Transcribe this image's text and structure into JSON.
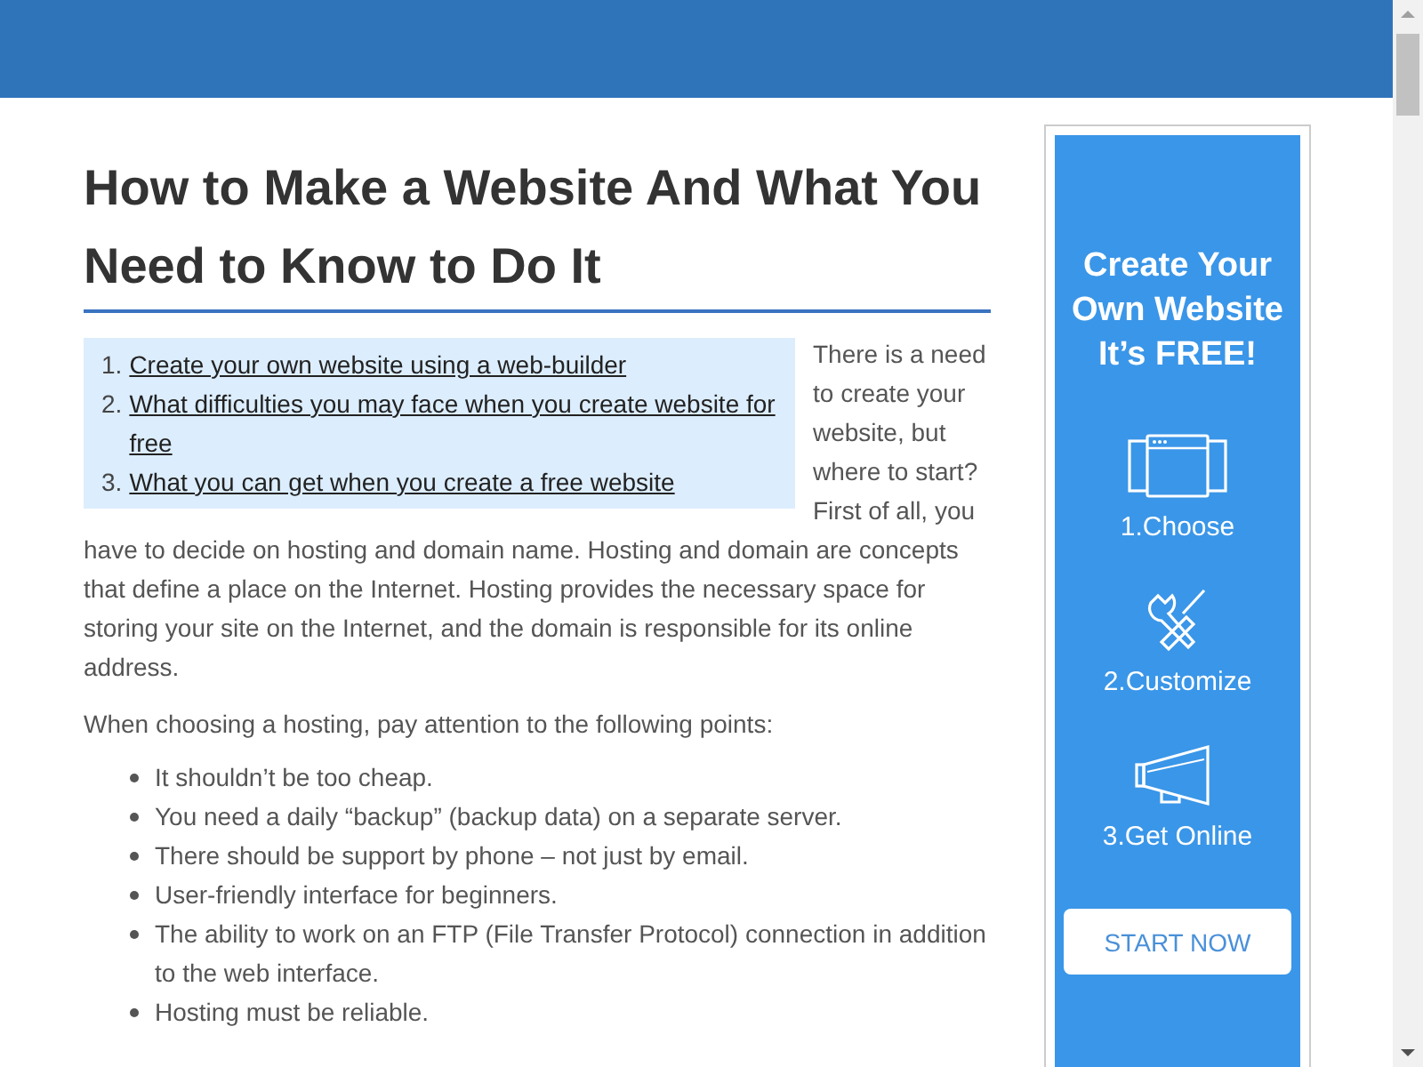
{
  "article": {
    "title": "How to Make a Website And What You Need to Know to Do It",
    "toc": [
      {
        "number": "1.",
        "text": "Create your own website using a web-builder"
      },
      {
        "number": "2.",
        "text": "What difficulties you may face when you create website for free"
      },
      {
        "number": "3.",
        "text": "What you can get when you create a free website"
      }
    ],
    "intro_side": "There is a need to create your website, but where to start? First of all, you",
    "intro_rest": "have to decide on hosting and domain name. Hosting and domain are concepts that define a place on the Internet. Hosting provides the necessary space for storing your site on the Internet, and the domain is responsible for its online address.",
    "lead": "When choosing a hosting, pay attention to the following points:",
    "points": [
      "It shouldn’t be too cheap.",
      "You need a daily “backup” (backup data) on a separate server.",
      "There should be support by phone – not just by email.",
      "User-friendly interface for beginners.",
      "The ability to work on an FTP (File Transfer Protocol) connection in addition to the web interface.",
      "Hosting must be reliable."
    ]
  },
  "ad": {
    "headline": "Create Your Own Website It’s FREE!",
    "steps": [
      {
        "kind": "browser",
        "label": "1.Choose"
      },
      {
        "kind": "tools",
        "label": "2.Customize"
      },
      {
        "kind": "megaphone",
        "label": "3.Get Online"
      }
    ],
    "button": "START NOW"
  }
}
